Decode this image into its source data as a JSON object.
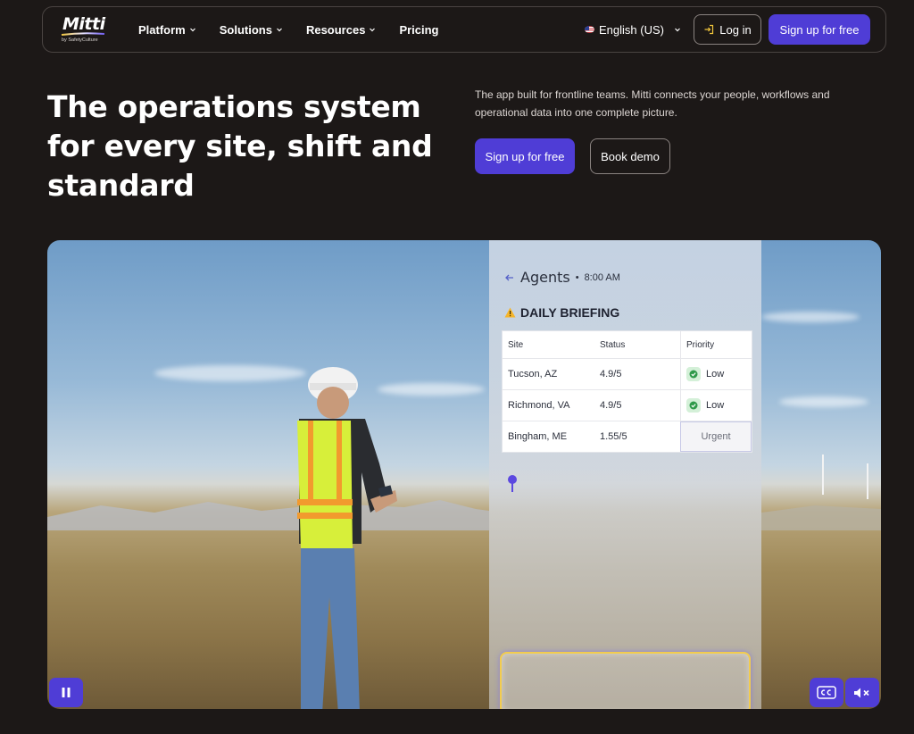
{
  "brand": {
    "name": "Mitti",
    "tagline": "by SafetyCulture"
  },
  "nav": {
    "items": [
      {
        "label": "Platform",
        "has_dropdown": true
      },
      {
        "label": "Solutions",
        "has_dropdown": true
      },
      {
        "label": "Resources",
        "has_dropdown": true
      },
      {
        "label": "Pricing",
        "has_dropdown": false
      }
    ],
    "language": "English (US)",
    "login_label": "Log in",
    "signup_label": "Sign up for free"
  },
  "hero": {
    "title": "The operations system for every site, shift and standard",
    "description": "The app built for frontline teams. Mitti connects your people, workflows and operational data into one complete picture.",
    "primary_cta": "Sign up for free",
    "secondary_cta": "Book demo"
  },
  "video": {
    "panel": {
      "heading": "Agents",
      "separator": "•",
      "time": "8:00 AM",
      "briefing_title": "DAILY BRIEFING",
      "table": {
        "headers": [
          "Site",
          "Status",
          "Priority"
        ],
        "rows": [
          {
            "site": "Tucson, AZ",
            "status": "4.9/5",
            "priority": "Low"
          },
          {
            "site": "Richmond, VA",
            "status": "4.9/5",
            "priority": "Low"
          },
          {
            "site": "Bingham, ME",
            "status": "1.55/5",
            "priority": "Urgent"
          }
        ]
      }
    },
    "controls": {
      "pause_icon": "pause-icon",
      "captions_icon": "closed-captions-icon",
      "mute_icon": "speaker-muted-icon"
    }
  },
  "colors": {
    "background": "#1c1817",
    "accent": "#4f3dd6",
    "low_badge": "#d4f0d8",
    "low_check": "#2f9a4a"
  }
}
